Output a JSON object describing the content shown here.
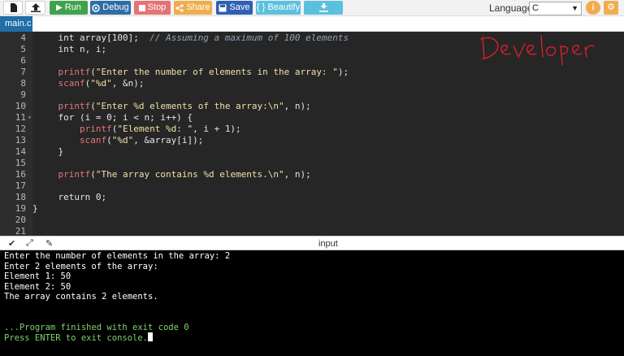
{
  "toolbar": {
    "run_label": "Run",
    "debug_label": "Debug",
    "stop_label": "Stop",
    "share_label": "Share",
    "save_label": "Save",
    "beautify_label": "{ } Beautify",
    "language_label": "Language",
    "language_value": "C"
  },
  "tabs": {
    "active": "main.c"
  },
  "editor": {
    "lines": [
      {
        "n": "4",
        "t": ""
      },
      {
        "n": "5",
        "t": ""
      },
      {
        "n": "6",
        "t": ""
      },
      {
        "n": "7",
        "t": ""
      },
      {
        "n": "8",
        "t": ""
      },
      {
        "n": "9",
        "t": ""
      },
      {
        "n": "10",
        "t": ""
      },
      {
        "n": "11",
        "t": ""
      },
      {
        "n": "12",
        "t": ""
      },
      {
        "n": "13",
        "t": ""
      },
      {
        "n": "14",
        "t": ""
      },
      {
        "n": "15",
        "t": ""
      },
      {
        "n": "16",
        "t": ""
      },
      {
        "n": "17",
        "t": ""
      },
      {
        "n": "18",
        "t": ""
      },
      {
        "n": "19",
        "t": ""
      },
      {
        "n": "20",
        "t": ""
      },
      {
        "n": "21",
        "t": ""
      }
    ],
    "code": {
      "l4_a": "    int array[100];  ",
      "l4_b": "// Assuming a maximum of 100 elements",
      "l5": "    int n, i;",
      "l7_fn": "printf",
      "l7_str": "\"Enter the number of elements in the array: \"",
      "l8_fn": "scanf",
      "l8_str": "\"%d\"",
      "l8_rest": ", &n);",
      "l10_fn": "printf",
      "l10_str": "\"Enter %d elements of the array:\\n\"",
      "l10_rest": ", n);",
      "l11": "    for (i = 0; i < n; i++) {",
      "l12_fn": "printf",
      "l12_str": "\"Element %d: \"",
      "l12_rest": ", i + 1);",
      "l13_fn": "scanf",
      "l13_str": "\"%d\"",
      "l13_rest": ", &array[i]);",
      "l14": "    }",
      "l16_fn": "printf",
      "l16_str": "\"The array contains %d elements.\\n\"",
      "l16_rest": ", n);",
      "l18": "    return 0;",
      "l19": "}"
    },
    "signature_text": "Developer"
  },
  "console": {
    "title": "input",
    "lines": [
      "Enter the number of elements in the array: 2",
      "Enter 2 elements of the array:",
      "Element 1: 50",
      "Element 2: 50",
      "The array contains 2 elements.",
      "",
      "",
      "...Program finished with exit code 0",
      "Press ENTER to exit console."
    ]
  },
  "colors": {
    "editor_bg": "#262626",
    "function": "#e5767a",
    "string": "#f0e0a8",
    "comment": "#8fa2b3",
    "signature": "#e0202a",
    "console_green": "#7cd56b"
  }
}
